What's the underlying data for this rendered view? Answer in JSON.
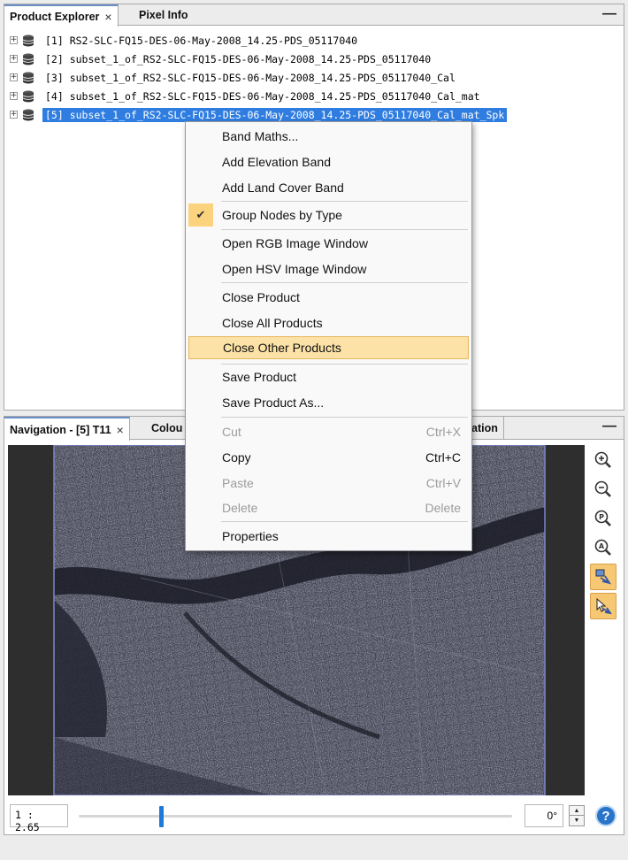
{
  "product_explorer": {
    "tabs": [
      {
        "label": "Product Explorer",
        "close": "×"
      },
      {
        "label": "Pixel Info"
      }
    ],
    "minimize": "—",
    "products": [
      {
        "label": "[1] RS2-SLC-FQ15-DES-06-May-2008_14.25-PDS_05117040",
        "expander": "+",
        "selected": false
      },
      {
        "label": "[2] subset_1_of_RS2-SLC-FQ15-DES-06-May-2008_14.25-PDS_05117040",
        "expander": "+",
        "selected": false
      },
      {
        "label": "[3] subset_1_of_RS2-SLC-FQ15-DES-06-May-2008_14.25-PDS_05117040_Cal",
        "expander": "+",
        "selected": false
      },
      {
        "label": "[4] subset_1_of_RS2-SLC-FQ15-DES-06-May-2008_14.25-PDS_05117040_Cal_mat",
        "expander": "+",
        "selected": false
      },
      {
        "label": "[5] subset_1_of_RS2-SLC-FQ15-DES-06-May-2008_14.25-PDS_05117040_Cal_mat_Spk",
        "expander": "+",
        "selected": true
      }
    ]
  },
  "context_menu": {
    "items": [
      {
        "label": "Band Maths...",
        "shortcut": "",
        "disabled": false
      },
      {
        "label": "Add Elevation Band",
        "shortcut": "",
        "disabled": false
      },
      {
        "label": "Add Land Cover Band",
        "shortcut": "",
        "disabled": false
      },
      {
        "label": "Group Nodes by Type",
        "shortcut": "",
        "disabled": false,
        "checked": true
      },
      {
        "label": "Open RGB Image Window",
        "shortcut": "",
        "disabled": false
      },
      {
        "label": "Open HSV Image Window",
        "shortcut": "",
        "disabled": false
      },
      {
        "label": "Close Product",
        "shortcut": "",
        "disabled": false
      },
      {
        "label": "Close All Products",
        "shortcut": "",
        "disabled": false
      },
      {
        "label": "Close Other Products",
        "shortcut": "",
        "disabled": false,
        "hovered": true
      },
      {
        "label": "Save Product",
        "shortcut": "",
        "disabled": false
      },
      {
        "label": "Save Product As...",
        "shortcut": "",
        "disabled": false
      },
      {
        "label": "Cut",
        "shortcut": "Ctrl+X",
        "disabled": true
      },
      {
        "label": "Copy",
        "shortcut": "Ctrl+C",
        "disabled": false
      },
      {
        "label": "Paste",
        "shortcut": "Ctrl+V",
        "disabled": true
      },
      {
        "label": "Delete",
        "shortcut": "Delete",
        "disabled": true
      },
      {
        "label": "Properties",
        "shortcut": "",
        "disabled": false
      }
    ],
    "check_glyph": "✔"
  },
  "navigation": {
    "tabs": [
      {
        "label": "Navigation - [5] T11",
        "close": "×"
      },
      {
        "label": "Colou"
      },
      {
        "label": "ation"
      }
    ],
    "minimize": "—",
    "tools": [
      {
        "icon": "zoom-in-icon"
      },
      {
        "icon": "zoom-out-icon"
      },
      {
        "icon": "zoom-pixel-icon"
      },
      {
        "icon": "zoom-all-icon"
      },
      {
        "icon": "sync-views-icon",
        "toggled": true
      },
      {
        "icon": "sync-cursor-icon",
        "toggled": true
      }
    ],
    "zoom_value": "1 : 2.65",
    "zoom_slider_fraction": 0.19,
    "angle_value": "0°",
    "help_label": "?"
  },
  "colors": {
    "selection": "#2f7de1",
    "hover_item": "#fce2a7",
    "toggle_active": "#f7c873",
    "slider_thumb": "#1e7ad8"
  }
}
